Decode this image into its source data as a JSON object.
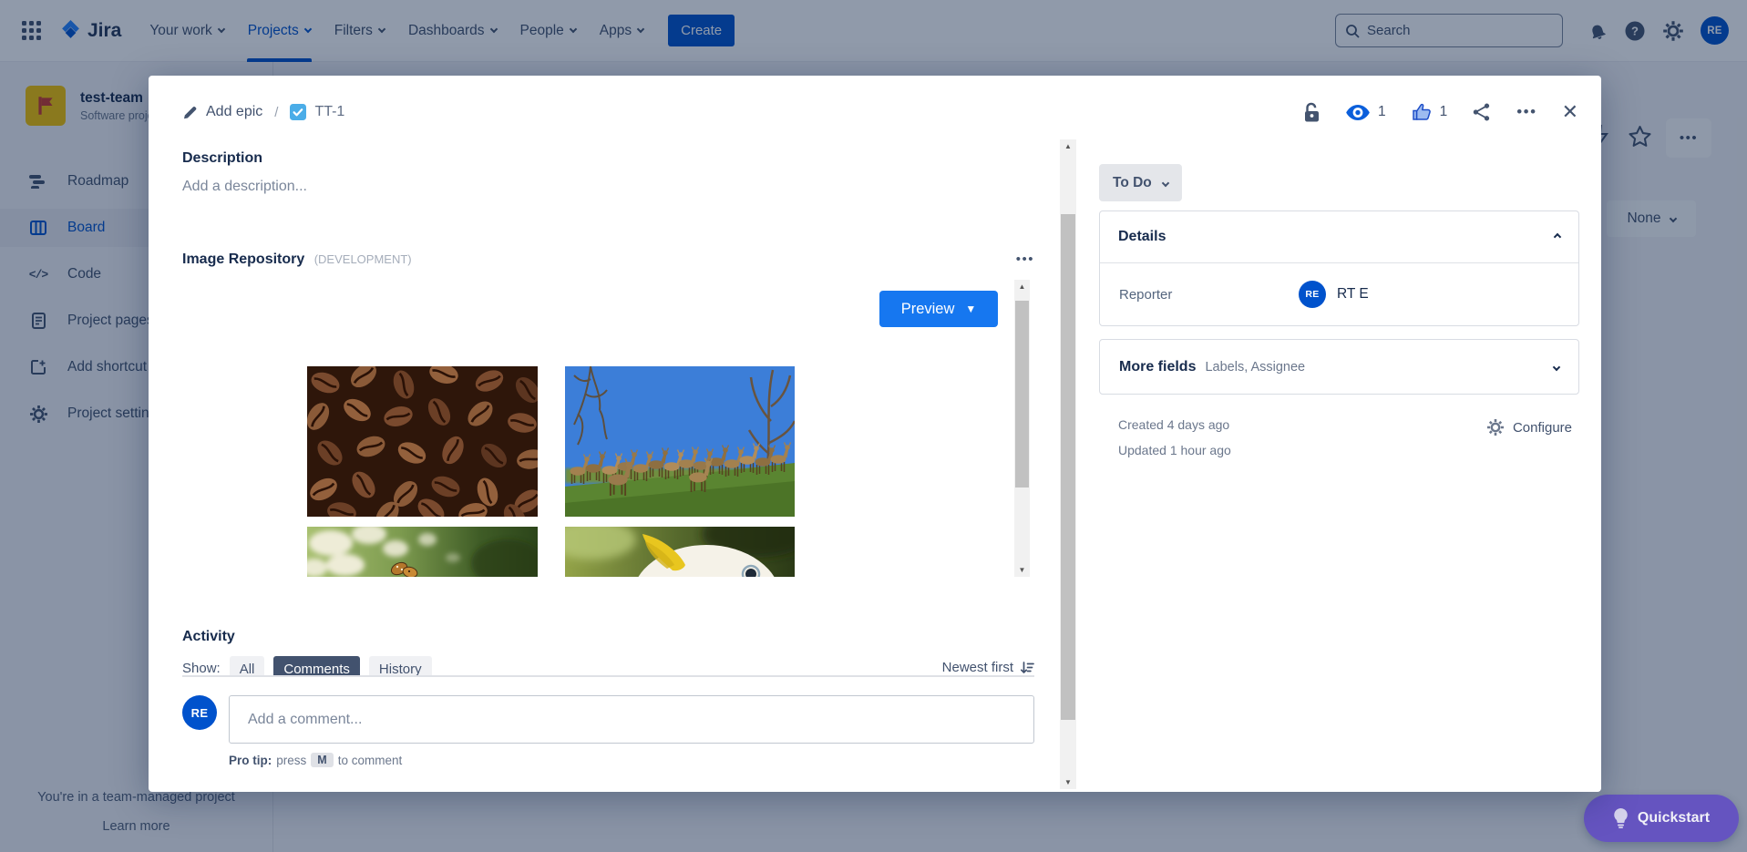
{
  "nav": {
    "logo_text": "Jira",
    "items": [
      {
        "label": "Your work"
      },
      {
        "label": "Projects",
        "active": true
      },
      {
        "label": "Filters"
      },
      {
        "label": "Dashboards"
      },
      {
        "label": "People"
      },
      {
        "label": "Apps"
      }
    ],
    "create_label": "Create",
    "search_placeholder": "Search",
    "avatar_initials": "RE"
  },
  "sidebar": {
    "project_name": "test-team",
    "project_type": "Software project",
    "items": [
      {
        "label": "Roadmap"
      },
      {
        "label": "Board",
        "selected": true
      },
      {
        "label": "Code"
      },
      {
        "label": "Project pages"
      },
      {
        "label": "Add shortcut"
      },
      {
        "label": "Project settings"
      }
    ],
    "footer_line1": "You're in a team-managed project",
    "footer_line2": "Learn more"
  },
  "board_page": {
    "epic_filter_label": "None",
    "quickstart_label": "Quickstart"
  },
  "modal": {
    "breadcrumb": {
      "parent": "Add epic",
      "slash": "/",
      "issue_key": "TT-1"
    },
    "header": {
      "watch_count": "1",
      "vote_count": "1"
    },
    "description": {
      "label": "Description",
      "placeholder": "Add a description..."
    },
    "panel": {
      "title": "Image Repository",
      "badge": "(DEVELOPMENT)",
      "preview_label": "Preview",
      "images": [
        {
          "name": "coffee-beans"
        },
        {
          "name": "deer-herd"
        },
        {
          "name": "white-flowers-butterfly"
        },
        {
          "name": "cockatoo"
        }
      ]
    },
    "activity": {
      "label": "Activity",
      "show_label": "Show:",
      "tabs": [
        {
          "label": "All"
        },
        {
          "label": "Comments",
          "selected": true
        },
        {
          "label": "History"
        }
      ],
      "sort_label": "Newest first"
    },
    "comment": {
      "avatar_initials": "RE",
      "placeholder": "Add a comment...",
      "protip_prefix": "Pro tip:",
      "protip_press": "press",
      "protip_key": "M",
      "protip_suffix": "to comment"
    },
    "sidebar": {
      "status": "To Do",
      "details_title": "Details",
      "reporter_label": "Reporter",
      "reporter_avatar": "RE",
      "reporter_name": "RT E",
      "more_fields_label": "More fields",
      "more_fields_hint": "Labels, Assignee",
      "created": "Created 4 days ago",
      "updated": "Updated 1 hour ago",
      "configure_label": "Configure"
    }
  },
  "icons": {
    "more": "•••",
    "close": "✕",
    "help_glyph": "?",
    "arrow_up": "▲",
    "arrow_down": "▼",
    "preview_caret": "▼"
  },
  "colors": {
    "accent_blue": "#0052CC",
    "preview_blue": "#1677F0",
    "task_icon_blue": "#4BADE8",
    "selected_tab": "#42526E",
    "quickstart_purple": "#6554C0",
    "project_tile_yellow": "#F5C400",
    "overlay": "rgba(9,30,66,0.45)"
  }
}
